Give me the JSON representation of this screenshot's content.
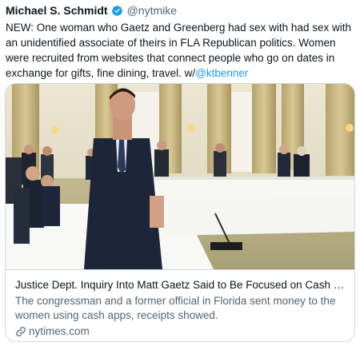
{
  "tweet": {
    "author_name": "Michael S. Schmidt",
    "handle": "@nytmike",
    "text_before_mention": "NEW: One woman who Gaetz and Greenberg had sex with had sex with an unidentified associate of theirs in FLA Republican politics. Women were recruited from websites that connect people who go on dates in exchange for gifts, fine dining, travel. w/",
    "mention": "@ktbenner"
  },
  "card": {
    "title": "Justice Dept. Inquiry Into Matt Gaetz Said to Be Focused on Cash Pa...",
    "description": "The congressman and a former official in Florida sent money to the women using cash apps, receipts showed.",
    "domain": "nytimes.com"
  },
  "icons": {
    "verified": "verified-badge-icon",
    "link": "link-icon"
  },
  "colors": {
    "verified": "#1d9bf0",
    "mention": "#1d9bf0",
    "secondary_text": "#536471"
  }
}
